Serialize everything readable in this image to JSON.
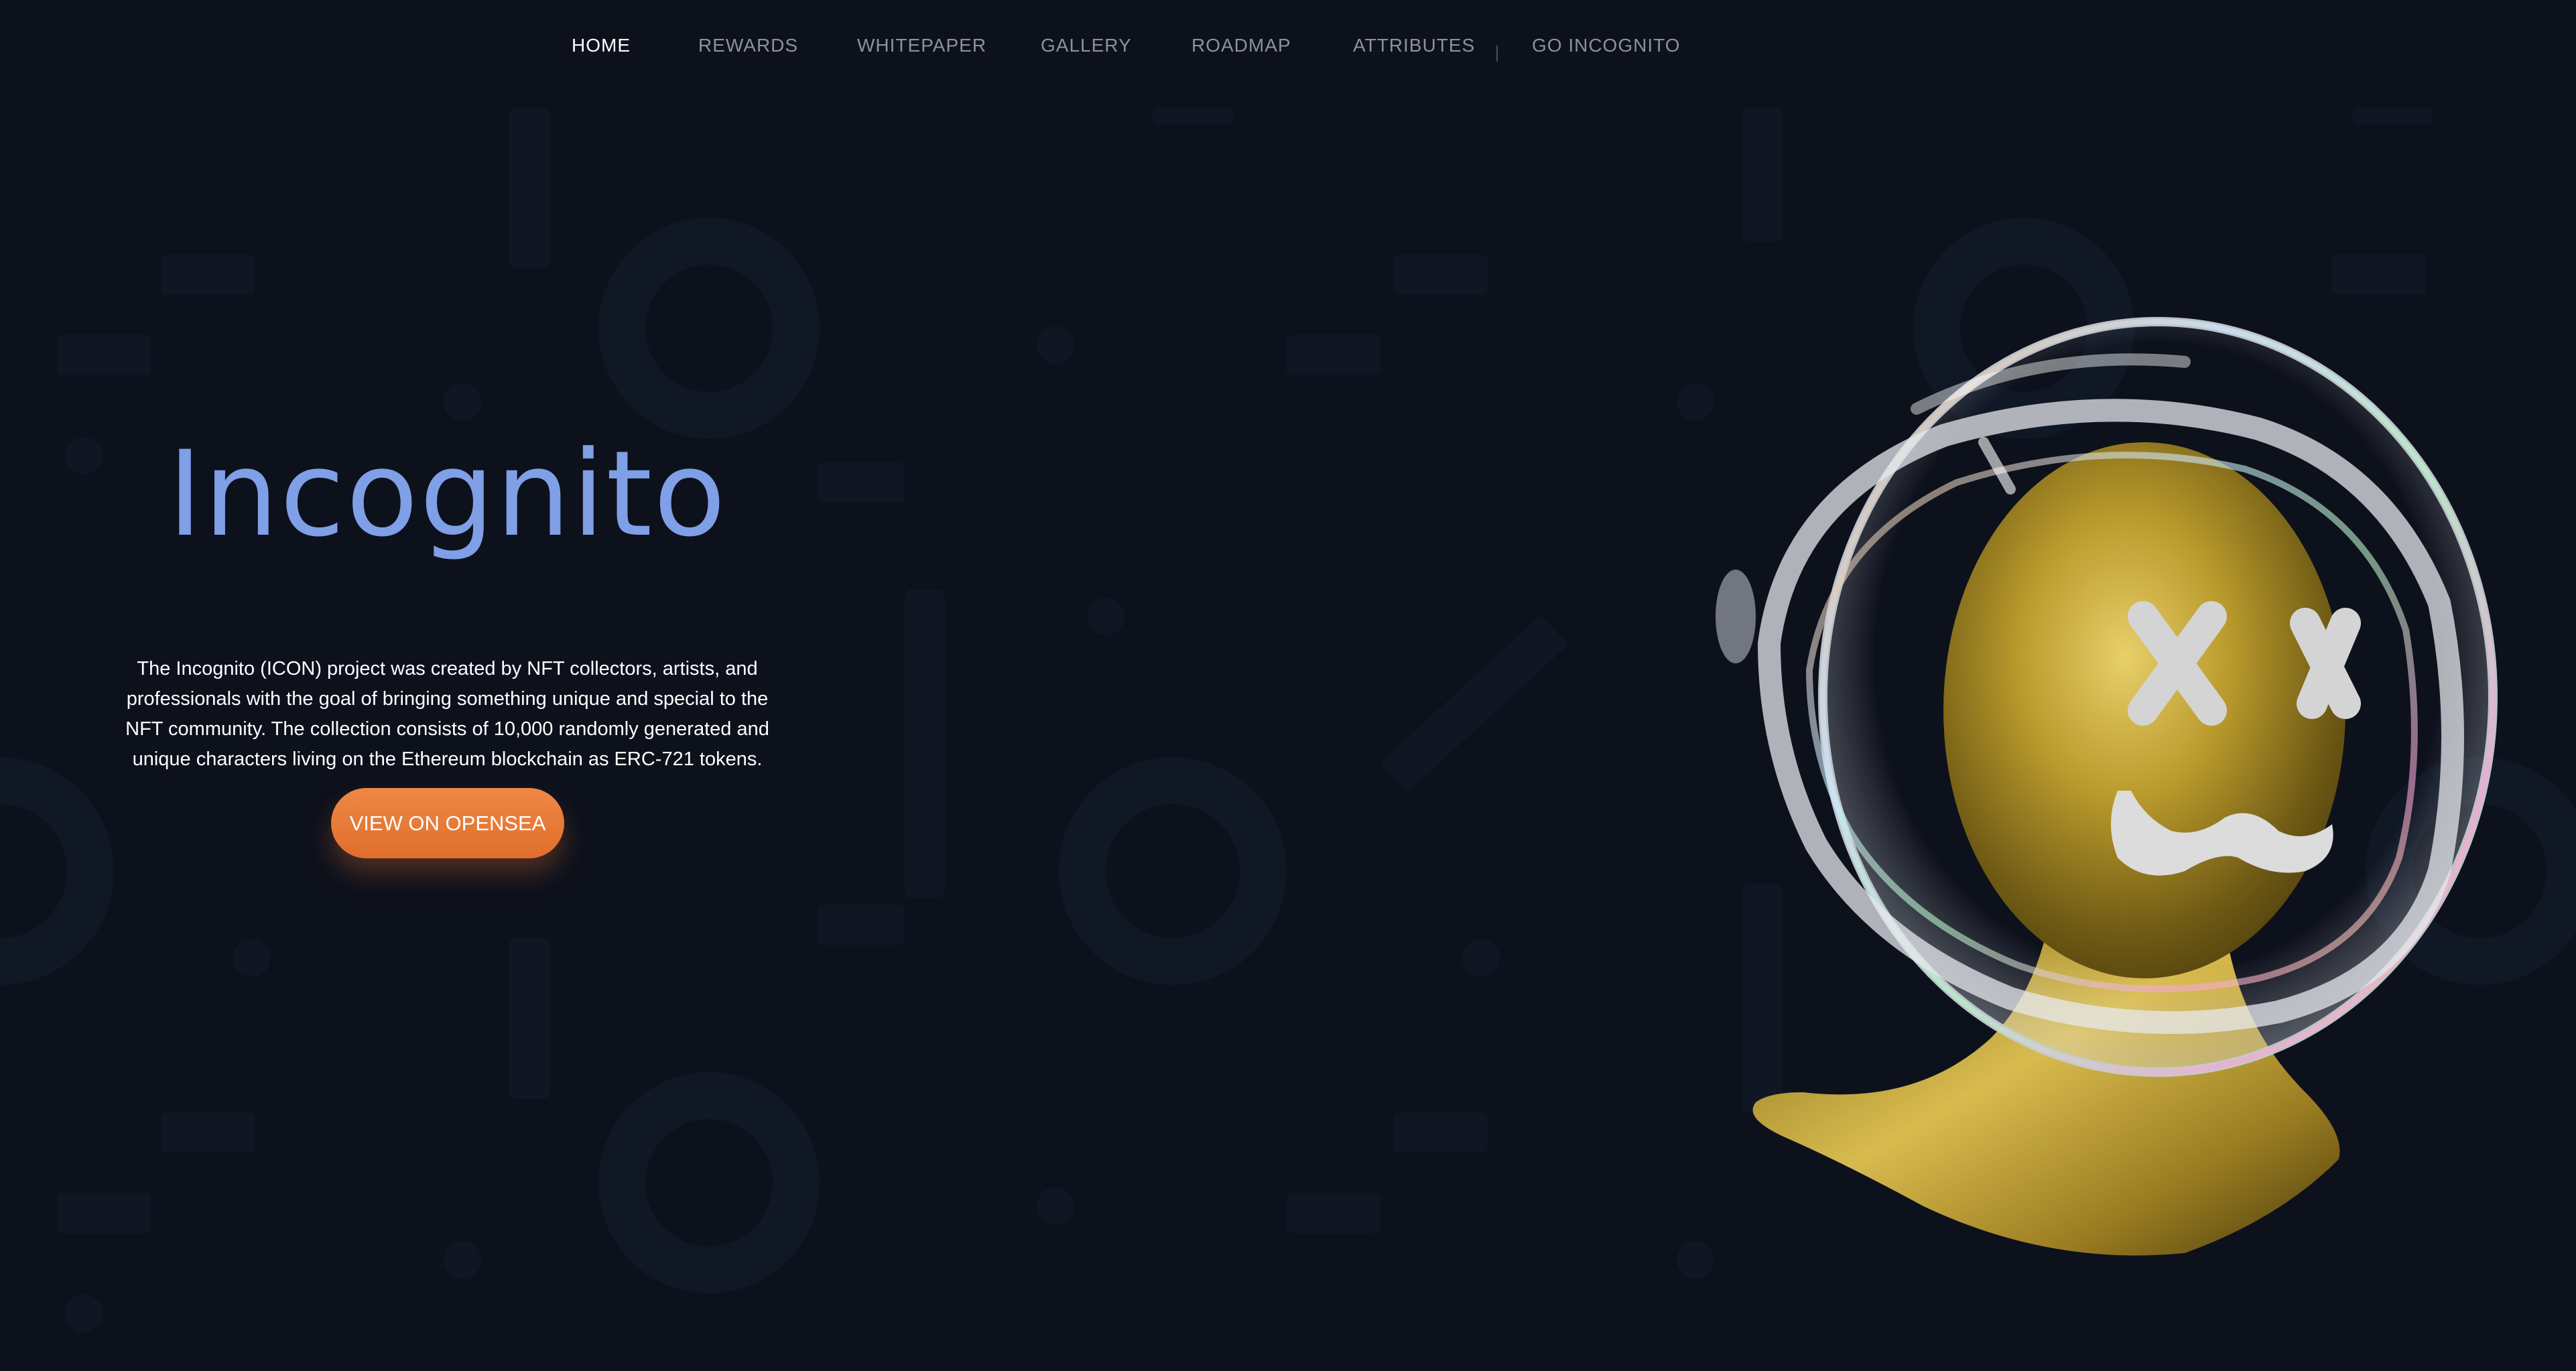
{
  "nav": {
    "items": [
      "HOME",
      "REWARDS",
      "WHITEPAPER",
      "GALLERY",
      "ROADMAP",
      "ATTRIBUTES"
    ],
    "active": "HOME",
    "cta": "GO INCOGNITO"
  },
  "hero": {
    "title": "Incognito",
    "description": "The Incognito (ICON) project was created by NFT collectors, artists, and professionals with the goal of bringing something unique and special to the NFT community. The collection consists of 10,000 randomly generated and unique characters living on the Ethereum blockchain as ERC-721 tokens.",
    "button": "VIEW ON OPENSEA"
  },
  "art": {
    "subject": "gold-mannequin-head-with-glass-astronaut-helmet"
  },
  "colors": {
    "background": "#0d111c",
    "title": "#7f9fe6",
    "button": "#e97a37",
    "nav_active": "#ffffff",
    "nav_inactive": "#8d919c"
  }
}
